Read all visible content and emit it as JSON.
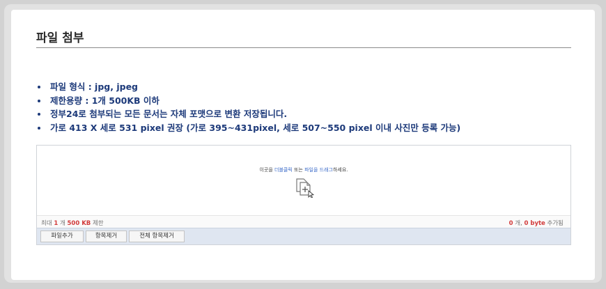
{
  "section": {
    "title": "파일 첨부"
  },
  "rules": [
    "파일 형식 : jpg, jpeg",
    "제한용량 : 1개 500KB 이하",
    "정부24로 첨부되는 모든 문서는 자체 포맷으로 변환 저장됩니다.",
    "가로 413 X 세로 531 pixel 권장 (가로 395~431pixel, 세로 507~550 pixel 이내 사진만 등록 가능)"
  ],
  "uploader": {
    "drop_prefix": "이곳을 ",
    "drop_dblclick": "더블클릭",
    "drop_middle": " 또는 ",
    "drop_drag": "파일을 드래그",
    "drop_suffix": "하세요.",
    "drop_icon": "add-file-icon",
    "limit_prefix": "최대 ",
    "limit_count": "1",
    "limit_unit": " 개 ",
    "limit_size": "500 KB",
    "limit_suffix": " 제한",
    "added_count": "0",
    "added_unit": " 개, ",
    "added_size": "0 byte",
    "added_suffix": " 추가됨",
    "buttons": {
      "add": "파일추가",
      "remove": "항목제거",
      "remove_all": "전체 항목제거"
    }
  },
  "colors": {
    "accent": "#1d3a7a",
    "link": "#3a6ac8",
    "warning": "#d23c3c",
    "toolbar_bg": "#dfe6f1"
  }
}
